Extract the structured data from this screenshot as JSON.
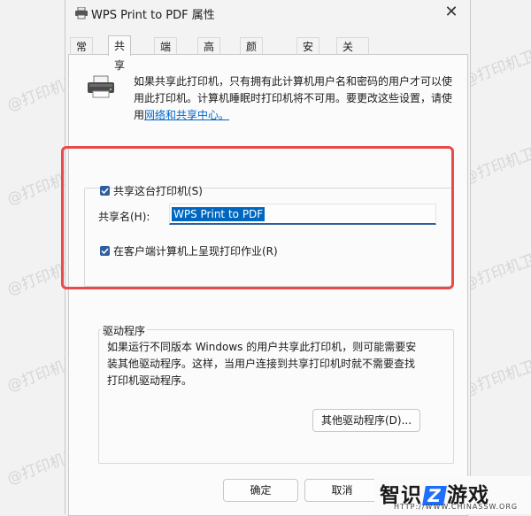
{
  "window": {
    "title": "WPS Print to PDF 属性",
    "close_glyph": "✕"
  },
  "tabs": [
    {
      "label": "常规"
    },
    {
      "label": "共享",
      "active": true
    },
    {
      "label": "端口"
    },
    {
      "label": "高级"
    },
    {
      "label": "颜色管理"
    },
    {
      "label": "安全"
    },
    {
      "label": "关于..."
    }
  ],
  "info": {
    "line1": "如果共享此打印机，只有拥有此计算机用户名和密码的用户才可以使",
    "line2": "用此打印机。计算机睡眠时打印机将不可用。要更改这些设置，请使",
    "line3_prefix": "用",
    "link": "网络和共享中心。"
  },
  "sharing": {
    "share_checkbox_label": "共享这台打印机(S)",
    "share_checked": true,
    "share_name_label": "共享名(H):",
    "share_name_value": "WPS Print to PDF",
    "render_checkbox_label": "在客户端计算机上呈现打印作业(R)",
    "render_checked": true
  },
  "drivers": {
    "group_label": "驱动程序",
    "line1": "如果运行不同版本 Windows 的用户共享此打印机，则可能需要安",
    "line2": "装其他驱动程序。这样，当用户连接到共享打印机时就不需要查找",
    "line3": "打印机驱动程序。",
    "button_label": "其他驱动程序(D)..."
  },
  "footer": {
    "ok_label": "确定",
    "cancel_label": "取消"
  },
  "watermark": {
    "text": "@打印机卫士"
  },
  "logo": {
    "main_before": "智识",
    "main_z": "Z",
    "main_after": "游戏",
    "url": "HTTP://WWW.CHINASSW.ORG"
  },
  "colors": {
    "accent": "#0067c0",
    "checkbox": "#2e5f9c",
    "highlight_box": "#ea4a4a",
    "link": "#0066cc"
  }
}
